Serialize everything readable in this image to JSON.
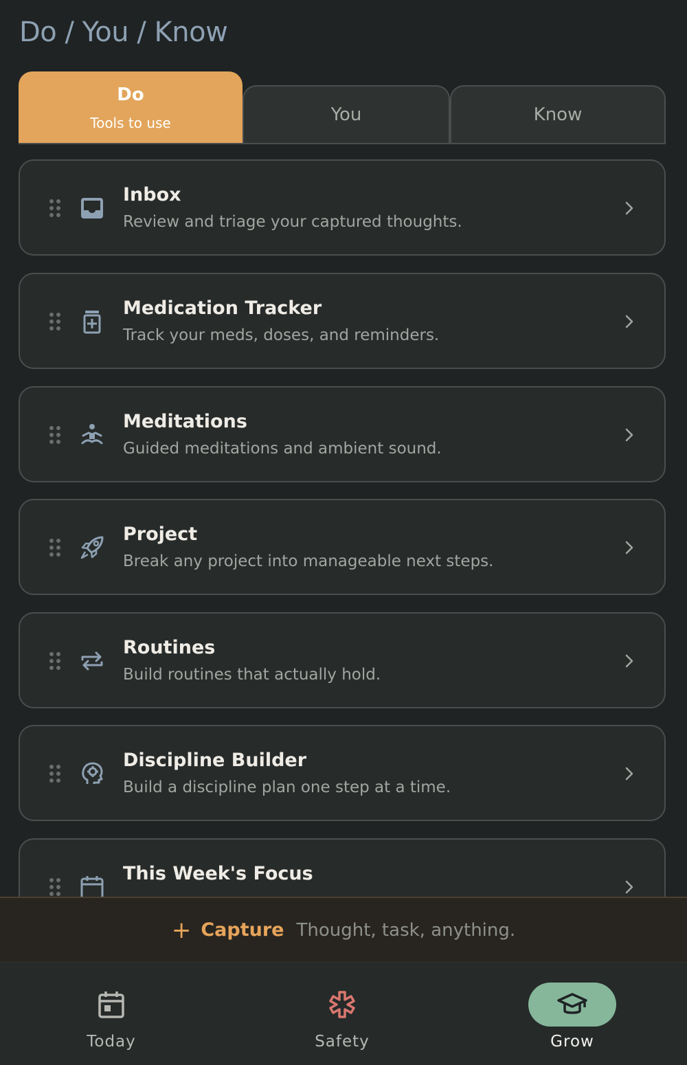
{
  "header": {
    "title": "Do / You / Know"
  },
  "tabs": [
    {
      "label": "Do",
      "sublabel": "Tools to use",
      "active": true
    },
    {
      "label": "You",
      "active": false
    },
    {
      "label": "Know",
      "active": false
    }
  ],
  "cards": [
    {
      "title": "Inbox",
      "desc": "Review and triage your captured thoughts.",
      "icon": "inbox-icon"
    },
    {
      "title": "Medication Tracker",
      "desc": "Track your meds, doses, and reminders.",
      "icon": "medication-icon"
    },
    {
      "title": "Meditations",
      "desc": "Guided meditations and ambient sound.",
      "icon": "meditation-icon"
    },
    {
      "title": "Project",
      "desc": "Break any project into manageable next steps.",
      "icon": "rocket-icon"
    },
    {
      "title": "Routines",
      "desc": "Build routines that actually hold.",
      "icon": "repeat-icon"
    },
    {
      "title": "Discipline Builder",
      "desc": "Build a discipline plan one step at a time.",
      "icon": "brain-gear-icon"
    },
    {
      "title": "This Week's Focus",
      "desc": "",
      "icon": "calendar-icon"
    }
  ],
  "capture": {
    "plus": "+",
    "label": "Capture",
    "placeholder": "Thought, task, anything."
  },
  "nav": [
    {
      "label": "Today",
      "icon": "calendar-today-icon"
    },
    {
      "label": "Safety",
      "icon": "asterisk-icon"
    },
    {
      "label": "Grow",
      "icon": "graduation-cap-icon",
      "active": true
    }
  ],
  "colors": {
    "background": "#1f2324",
    "accent": "#e2a55b",
    "grow_pill": "#86b79b",
    "safety_icon": "#d9776f"
  }
}
